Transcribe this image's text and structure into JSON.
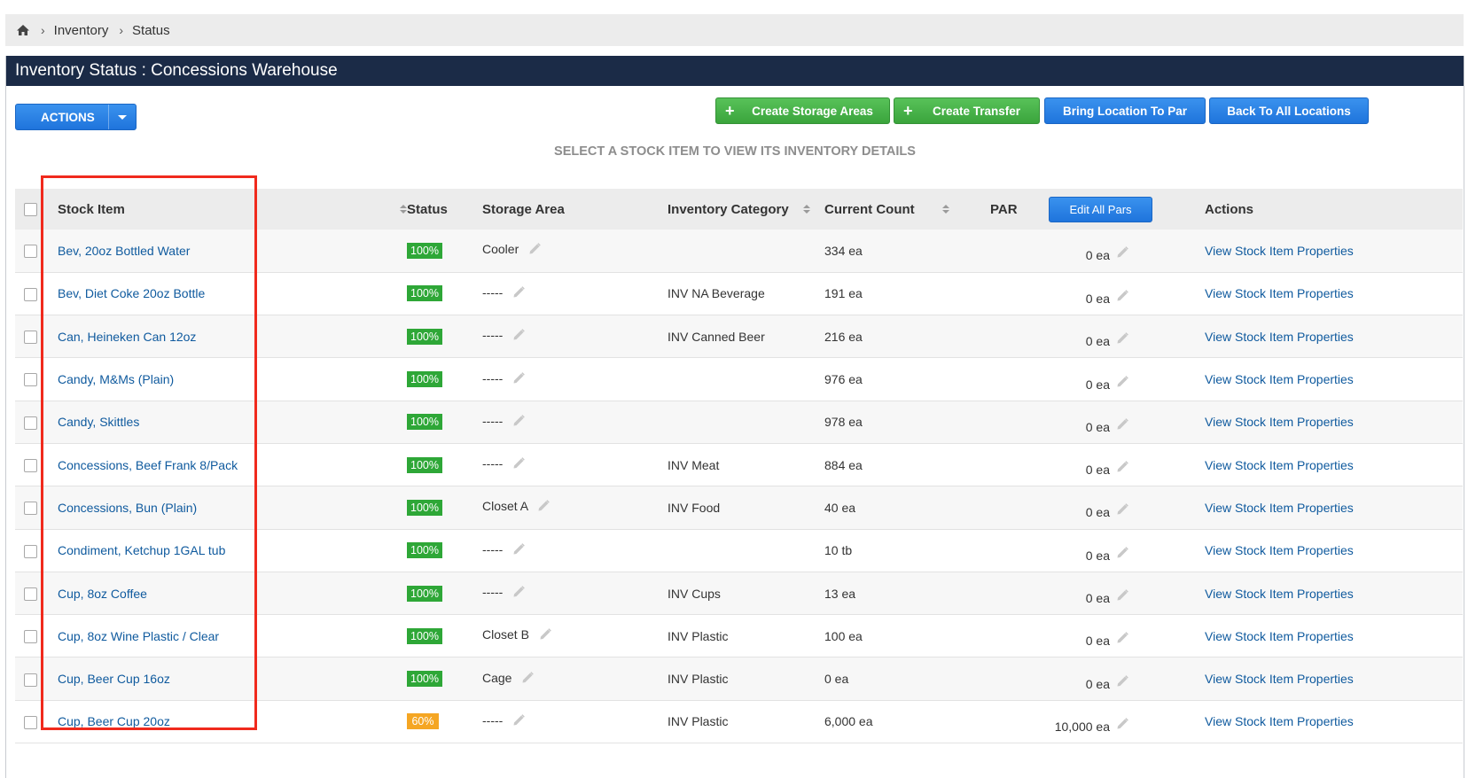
{
  "breadcrumb": {
    "items": [
      "Inventory",
      "Status"
    ]
  },
  "panel": {
    "title": "Inventory Status : Concessions Warehouse"
  },
  "toolbar": {
    "actions_label": "ACTIONS",
    "create_storage_label": "Create Storage Areas",
    "create_transfer_label": "Create Transfer",
    "bring_to_par_label": "Bring Location To Par",
    "back_label": "Back To All Locations"
  },
  "hint": "SELECT A STOCK ITEM TO VIEW ITS INVENTORY DETAILS",
  "table": {
    "headers": {
      "stock_item": "Stock Item",
      "status": "Status",
      "storage_area": "Storage Area",
      "inventory_category": "Inventory Category",
      "current_count": "Current Count",
      "par": "PAR",
      "edit_all_pars": "Edit All Pars",
      "actions": "Actions"
    },
    "rows": [
      {
        "item": "Bev, 20oz Bottled Water",
        "status": "100%",
        "status_color": "#2ea737",
        "storage": "Cooler",
        "category": "",
        "count": "334 ea",
        "par": "0 ea",
        "action": "View Stock Item Properties"
      },
      {
        "item": "Bev, Diet Coke 20oz Bottle",
        "status": "100%",
        "status_color": "#2ea737",
        "storage": "-----",
        "category": "INV NA Beverage",
        "count": "191 ea",
        "par": "0 ea",
        "action": "View Stock Item Properties"
      },
      {
        "item": "Can, Heineken Can 12oz",
        "status": "100%",
        "status_color": "#2ea737",
        "storage": "-----",
        "category": "INV Canned Beer",
        "count": "216 ea",
        "par": "0 ea",
        "action": "View Stock Item Properties"
      },
      {
        "item": "Candy, M&Ms (Plain)",
        "status": "100%",
        "status_color": "#2ea737",
        "storage": "-----",
        "category": "",
        "count": "976 ea",
        "par": "0 ea",
        "action": "View Stock Item Properties"
      },
      {
        "item": "Candy, Skittles",
        "status": "100%",
        "status_color": "#2ea737",
        "storage": "-----",
        "category": "",
        "count": "978 ea",
        "par": "0 ea",
        "action": "View Stock Item Properties"
      },
      {
        "item": "Concessions, Beef Frank 8/Pack",
        "status": "100%",
        "status_color": "#2ea737",
        "storage": "-----",
        "category": "INV Meat",
        "count": "884 ea",
        "par": "0 ea",
        "action": "View Stock Item Properties"
      },
      {
        "item": "Concessions, Bun (Plain)",
        "status": "100%",
        "status_color": "#2ea737",
        "storage": "Closet A",
        "category": "INV Food",
        "count": "40 ea",
        "par": "0 ea",
        "action": "View Stock Item Properties"
      },
      {
        "item": "Condiment, Ketchup 1GAL tub",
        "status": "100%",
        "status_color": "#2ea737",
        "storage": "-----",
        "category": "",
        "count": "10 tb",
        "par": "0 ea",
        "action": "View Stock Item Properties"
      },
      {
        "item": "Cup, 8oz Coffee",
        "status": "100%",
        "status_color": "#2ea737",
        "storage": "-----",
        "category": "INV Cups",
        "count": "13 ea",
        "par": "0 ea",
        "action": "View Stock Item Properties"
      },
      {
        "item": "Cup, 8oz Wine Plastic / Clear",
        "status": "100%",
        "status_color": "#2ea737",
        "storage": "Closet B",
        "category": "INV Plastic",
        "count": "100 ea",
        "par": "0 ea",
        "action": "View Stock Item Properties"
      },
      {
        "item": "Cup, Beer Cup 16oz",
        "status": "100%",
        "status_color": "#2ea737",
        "storage": "Cage",
        "category": "INV Plastic",
        "count": "0 ea",
        "par": "0 ea",
        "action": "View Stock Item Properties"
      },
      {
        "item": "Cup, Beer Cup 20oz",
        "status": "60%",
        "status_color": "#f5a623",
        "storage": "-----",
        "category": "INV Plastic",
        "count": "6,000 ea",
        "par": "10,000 ea",
        "action": "View Stock Item Properties"
      }
    ]
  },
  "colors": {
    "header_bg": "#1b2b47",
    "link": "#0f5a9e",
    "highlight": "#f02a1d"
  }
}
